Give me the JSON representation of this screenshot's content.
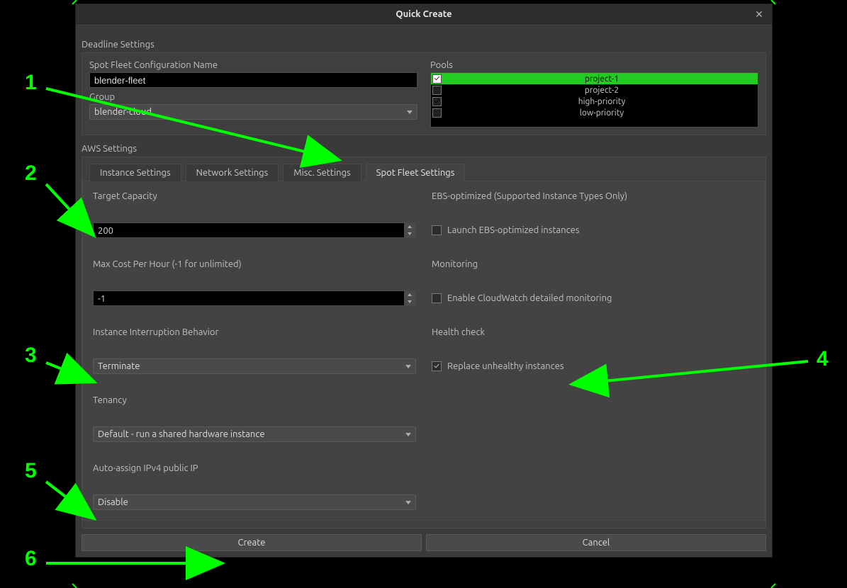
{
  "dialog": {
    "title": "Quick Create"
  },
  "deadline": {
    "section_label": "Deadline Settings",
    "config_name_label": "Spot Fleet Configuration Name",
    "config_name_value": "blender-fleet",
    "group_label": "Group",
    "group_value": "blender-cloud",
    "pools_label": "Pools",
    "pools": [
      {
        "label": "project-1",
        "checked": true,
        "selected": true
      },
      {
        "label": "project-2",
        "checked": false,
        "selected": false
      },
      {
        "label": "high-priority",
        "checked": true,
        "selected": false
      },
      {
        "label": "low-priority",
        "checked": false,
        "selected": false
      }
    ]
  },
  "aws": {
    "section_label": "AWS Settings",
    "tabs": [
      {
        "label": "Instance Settings"
      },
      {
        "label": "Network Settings"
      },
      {
        "label": "Misc. Settings"
      },
      {
        "label": "Spot Fleet Settings"
      }
    ],
    "active_tab_index": 3,
    "panel": {
      "target_capacity_label": "Target Capacity",
      "target_capacity_value": "200",
      "ebs_label": "EBS-optimized (Supported Instance Types Only)",
      "ebs_checkbox_label": "Launch EBS-optimized instances",
      "ebs_checked": false,
      "max_cost_label": "Max Cost Per Hour (-1 for unlimited)",
      "max_cost_value": "-1",
      "monitoring_label": "Monitoring",
      "monitoring_checkbox_label": "Enable CloudWatch detailed monitoring",
      "monitoring_checked": false,
      "interruption_label": "Instance Interruption Behavior",
      "interruption_value": "Terminate",
      "health_label": "Health check",
      "health_checkbox_label": "Replace unhealthy instances",
      "health_checked": true,
      "tenancy_label": "Tenancy",
      "tenancy_value": "Default - run a shared hardware instance",
      "ip_label": "Auto-assign IPv4 public IP",
      "ip_value": "Disable"
    }
  },
  "buttons": {
    "create": "Create",
    "cancel": "Cancel"
  },
  "annotations": {
    "n1": "1",
    "n2": "2",
    "n3": "3",
    "n4": "4",
    "n5": "5",
    "n6": "6"
  }
}
